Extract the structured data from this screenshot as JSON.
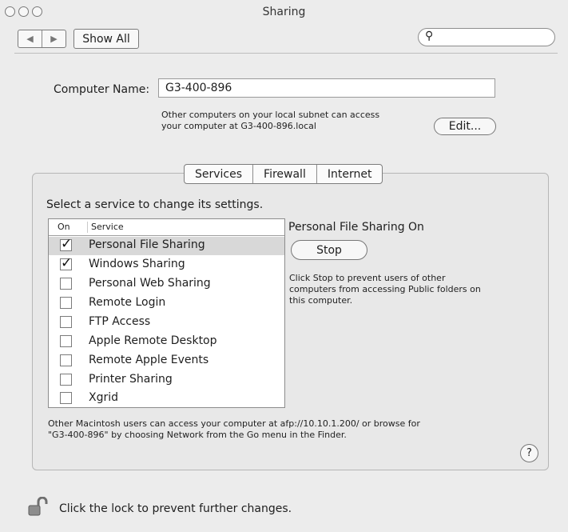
{
  "window": {
    "title": "Sharing"
  },
  "toolbar": {
    "back_glyph": "◀",
    "forward_glyph": "▶",
    "show_all_label": "Show All",
    "search_placeholder": ""
  },
  "computer": {
    "name_label": "Computer Name:",
    "name_value": "G3-400-896",
    "subnet_line1": "Other computers on your local subnet can access",
    "subnet_line2": "your computer at G3-400-896.local",
    "edit_label": "Edit..."
  },
  "tabs": [
    {
      "label": "Services"
    },
    {
      "label": "Firewall"
    },
    {
      "label": "Internet"
    }
  ],
  "services": {
    "instruction": "Select a service to change its settings.",
    "col_on": "On",
    "col_service": "Service",
    "items": [
      {
        "label": "Personal File Sharing",
        "checked": true
      },
      {
        "label": "Windows Sharing",
        "checked": true
      },
      {
        "label": "Personal Web Sharing",
        "checked": false
      },
      {
        "label": "Remote Login",
        "checked": false
      },
      {
        "label": "FTP Access",
        "checked": false
      },
      {
        "label": "Apple Remote Desktop",
        "checked": false
      },
      {
        "label": "Remote Apple Events",
        "checked": false
      },
      {
        "label": "Printer Sharing",
        "checked": false
      },
      {
        "label": "Xgrid",
        "checked": false
      }
    ],
    "status_title": "Personal File Sharing On",
    "stop_label": "Stop",
    "stop_desc_1": "Click Stop to prevent users of other",
    "stop_desc_2": "computers from accessing Public folders on",
    "stop_desc_3": "this computer.",
    "footer_1": "Other Macintosh users can access your computer at afp://10.10.1.200/ or browse for",
    "footer_2": "\"G3-400-896\" by choosing Network from the Go menu in the Finder.",
    "help_label": "?"
  },
  "lock": {
    "message": "Click the lock to prevent further changes."
  },
  "icons": {
    "search": "search-icon",
    "lock": "lock-open-icon",
    "help": "help-icon"
  }
}
